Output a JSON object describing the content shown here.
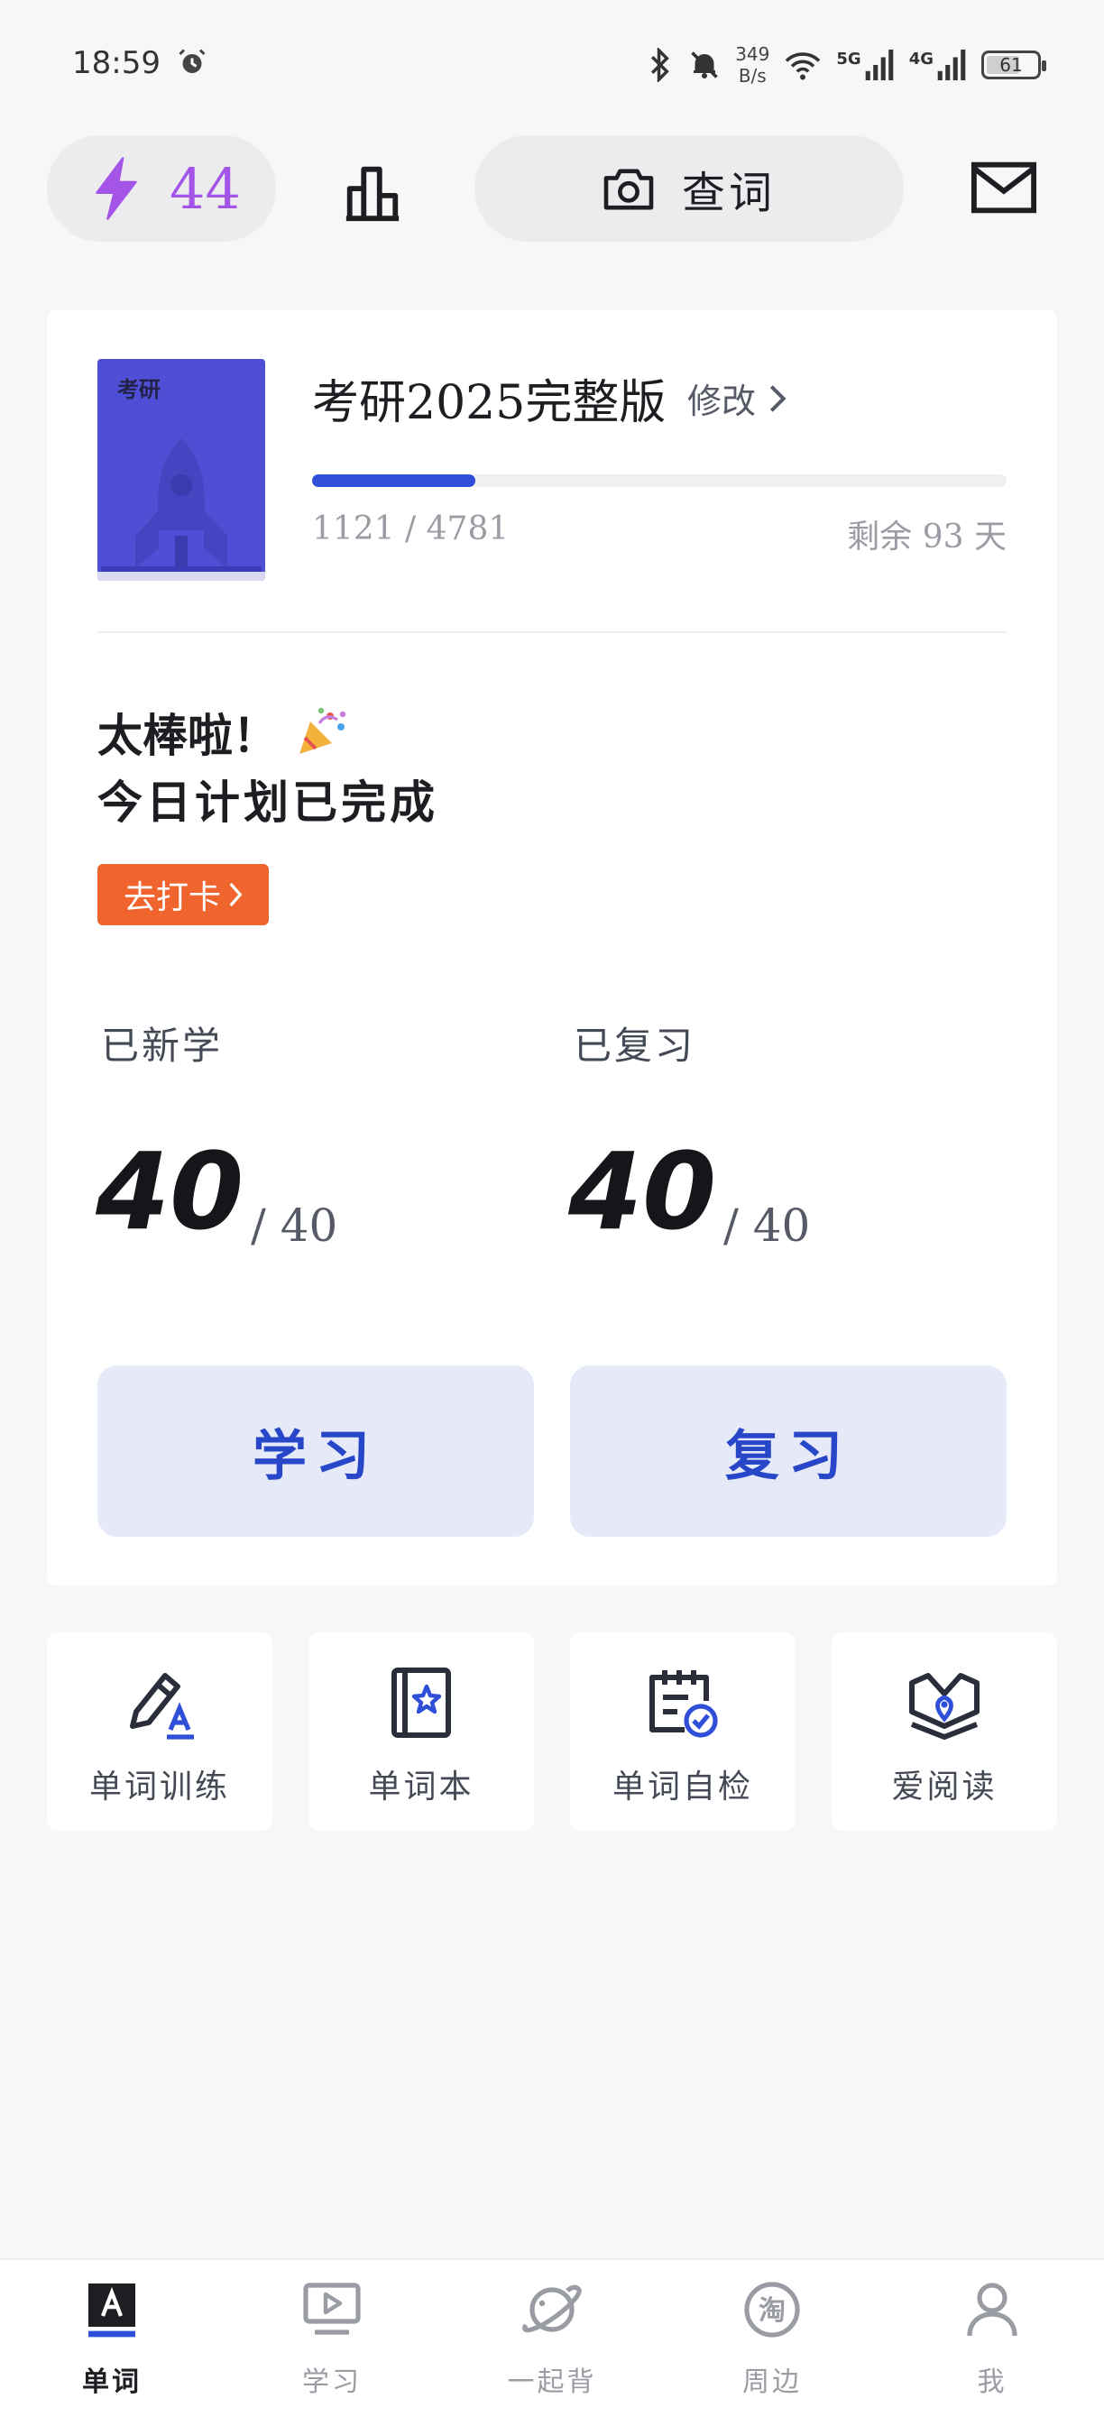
{
  "status_bar": {
    "time": "18:59",
    "net_speed_value": "349",
    "net_speed_unit": "B/s",
    "signal_1": "5G",
    "signal_2": "4G",
    "battery": "61"
  },
  "toolbar": {
    "energy_count": "44",
    "search_label": "查词"
  },
  "book": {
    "cover_tag": "考研",
    "title": "考研2025完整版",
    "modify_label": "修改",
    "progress_learned": 1121,
    "progress_total": 4781,
    "progress_text": "1121 / 4781",
    "days_left": "剩余 93 天"
  },
  "plan": {
    "line1": "太棒啦！",
    "line2": "今日计划已完成",
    "checkin_label": "去打卡"
  },
  "stats": {
    "new_label": "已新学",
    "new_count": "40",
    "new_total": "/ 40",
    "review_label": "已复习",
    "review_count": "40",
    "review_total": "/ 40"
  },
  "actions": {
    "learn_label": "学习",
    "review_label": "复习"
  },
  "tools": [
    {
      "label": "单词训练",
      "icon": "pencil-letter-icon"
    },
    {
      "label": "单词本",
      "icon": "wordbook-star-icon"
    },
    {
      "label": "单词自检",
      "icon": "calendar-check-icon"
    },
    {
      "label": "爱阅读",
      "icon": "open-book-icon"
    }
  ],
  "nav": [
    {
      "label": "单词",
      "active": true
    },
    {
      "label": "学习",
      "active": false
    },
    {
      "label": "一起背",
      "active": false
    },
    {
      "label": "周边",
      "active": false
    },
    {
      "label": "我",
      "active": false
    }
  ],
  "colors": {
    "accent": "#2f4fd9",
    "energy": "#a455e8",
    "checkin": "#f0642e",
    "action_bg": "#e6eaf8"
  }
}
